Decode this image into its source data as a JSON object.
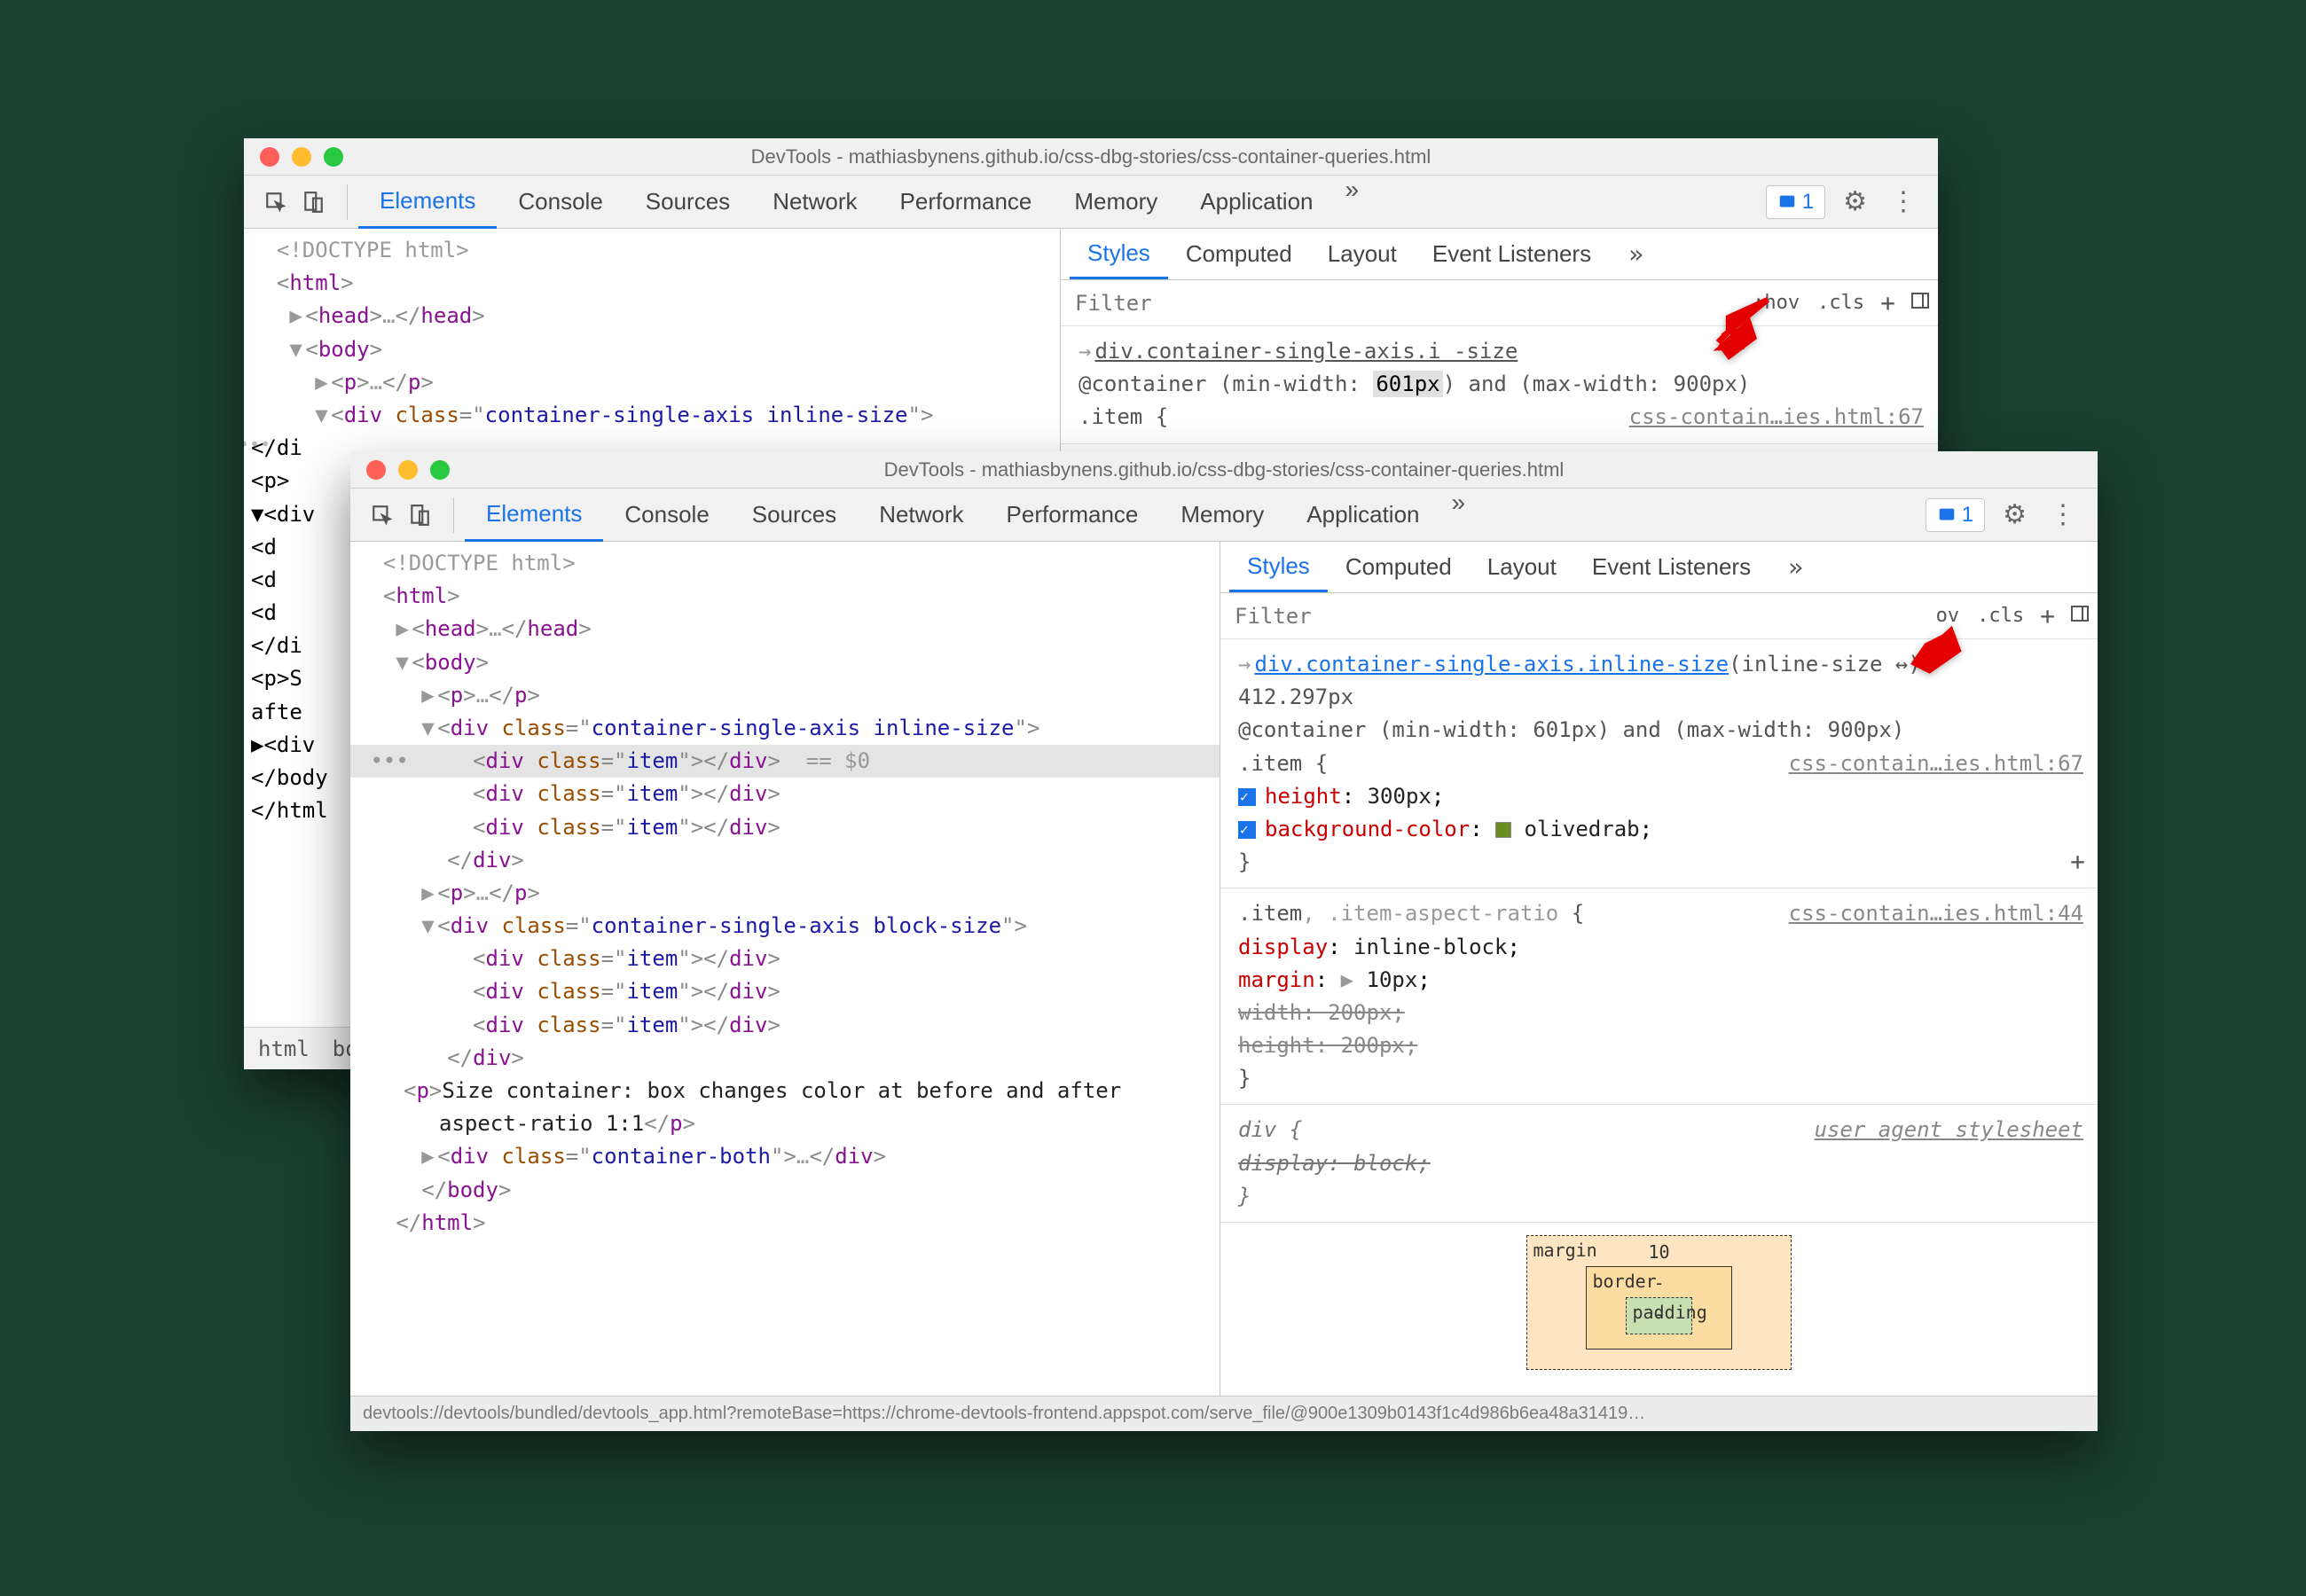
{
  "back": {
    "title": "DevTools - mathiasbynens.github.io/css-dbg-stories/css-container-queries.html",
    "tabs": [
      "Elements",
      "Console",
      "Sources",
      "Network",
      "Performance",
      "Memory",
      "Application"
    ],
    "active_tab": "Elements",
    "error_count": "1",
    "dom": {
      "doctype": "<!DOCTYPE html>",
      "html_open": "html",
      "head": "head",
      "body_open": "body",
      "p1": "p",
      "div_class": "container-single-axis inline-size",
      "body_close": "body",
      "html_close": "html"
    },
    "dom_trunc": [
      "</di",
      "<p>",
      "▼<div",
      "<d",
      "<d",
      "<d",
      "</di",
      "<p>S",
      "afte",
      "▶<div",
      "</body",
      "</html"
    ],
    "crumbs": [
      "html",
      "bod"
    ],
    "styles": {
      "subtabs": [
        "Styles",
        "Computed",
        "Layout",
        "Event Listeners"
      ],
      "active_subtab": "Styles",
      "filter_placeholder": "Filter",
      "hov": ":hov",
      "cls": ".cls",
      "selector_crumb": "div.container-single-axis.i        -size",
      "container_query": "@container (min-width: 601px) and (max-width: 900px)",
      "highlighted_value": "601px",
      "open_sel": ".item {",
      "loc": "css-contain…ies.html:67"
    }
  },
  "front": {
    "title": "DevTools - mathiasbynens.github.io/css-dbg-stories/css-container-queries.html",
    "tabs": [
      "Elements",
      "Console",
      "Sources",
      "Network",
      "Performance",
      "Memory",
      "Application"
    ],
    "active_tab": "Elements",
    "error_count": "1",
    "dom": {
      "doctype": "<!DOCTYPE html>",
      "html": "html",
      "head": "head",
      "body": "body",
      "p": "p",
      "div1_class": "container-single-axis inline-size",
      "item": "item",
      "sel_suffix": "== $0",
      "p2": "p",
      "div2_class": "container-single-axis block-size",
      "ptext": "Size container: box changes color at before and after aspect-ratio 1:1",
      "div3_class": "container-both"
    },
    "styles": {
      "subtabs": [
        "Styles",
        "Computed",
        "Layout",
        "Event Listeners"
      ],
      "active_subtab": "Styles",
      "filter_placeholder": "Filter",
      "ov": "ov",
      "cls": ".cls",
      "r1_selector": "div.container-single-axis.inline-size",
      "r1_hint": "(inline-size ↔)",
      "r1_size": "412.297px",
      "r1_cq": "@container (min-width: 601px) and (max-width: 900px)",
      "r1_open": ".item {",
      "r1_loc": "css-contain…ies.html:67",
      "r1_p1_name": "height",
      "r1_p1_val": "300px",
      "r1_p2_name": "background-color",
      "r1_p2_val": "olivedrab",
      "r2_sel": ".item, .item-aspect-ratio {",
      "r2_loc": "css-contain…ies.html:44",
      "r2_p1_name": "display",
      "r2_p1_val": "inline-block",
      "r2_p2_name": "margin",
      "r2_p2_val": "10px",
      "r2_p3_name": "width",
      "r2_p3_val": "200px",
      "r2_p4_name": "height",
      "r2_p4_val": "200px",
      "r3_sel": "div {",
      "r3_loc": "user agent stylesheet",
      "r3_p1_name": "display",
      "r3_p1_val": "block",
      "box_model": {
        "margin": "margin",
        "margin_top": "10",
        "border": "border",
        "border_val": "-",
        "padding": "padding",
        "padding_val": "-"
      },
      "statusbar": "devtools://devtools/bundled/devtools_app.html?remoteBase=https://chrome-devtools-frontend.appspot.com/serve_file/@900e1309b0143f1c4d986b6ea48a31419…"
    }
  }
}
